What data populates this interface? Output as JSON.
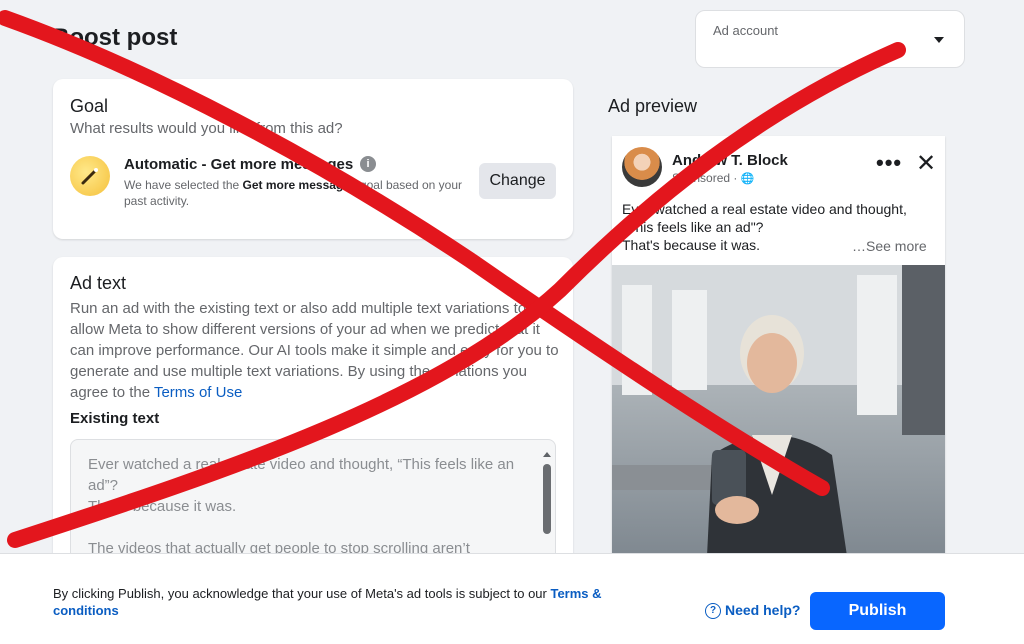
{
  "page_title": "Boost post",
  "ad_account": {
    "label": "Ad account"
  },
  "goal": {
    "heading": "Goal",
    "subtitle": "What results would you like from this ad?",
    "title": "Automatic - Get more messages",
    "desc_prefix": "We have selected the ",
    "desc_bold": "Get more messages",
    "desc_suffix": " goal based on your past activity.",
    "change_label": "Change",
    "info_glyph": "i"
  },
  "ad_text": {
    "heading": "Ad text",
    "description": "Run an ad with the existing text or also add multiple text variations to allow Meta to show different versions of your ad when we predict that it can improve performance. Our AI tools make it simple and easy for you to generate and use multiple text variations. By using the variations you agree to the ",
    "terms_link": "Terms of Use",
    "existing_label": "Existing text",
    "existing_text": "Ever watched a real estate video and thought, “This feels like an ad”?\nThat’s because it was.\n\nThe videos that actually get people to stop scrolling aren’t"
  },
  "preview": {
    "heading": "Ad preview",
    "page_name": "Andrew T. Block",
    "sponsored": "Sponsored · ",
    "globe": "🌐",
    "more": "•••",
    "close": "✕",
    "post_text": "Ever watched a real estate video and thought, \"This feels like an ad\"?\nThat's because it was.",
    "see_more": "…See more"
  },
  "footer": {
    "text": "By clicking Publish, you acknowledge that your use of Meta's ad tools is subject to our ",
    "terms_link": "Terms & conditions",
    "help_label": "Need help?",
    "help_glyph": "?",
    "publish_label": "Publish"
  },
  "colors": {
    "accent": "#0866ff",
    "link": "#0a5dc2",
    "cross": "#e3161d",
    "background": "#f0f2f5"
  }
}
